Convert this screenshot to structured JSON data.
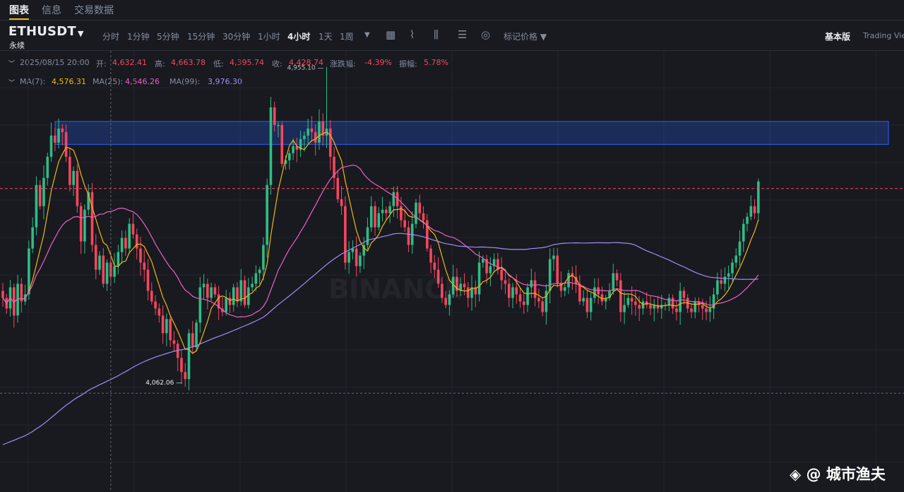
{
  "tabs": {
    "chart": "图表",
    "info": "信息",
    "trading_data": "交易数据"
  },
  "toolbar": {
    "symbol": "ETHUSDT",
    "contract_type": "永续",
    "intervals": [
      "分时",
      "1分钟",
      "5分钟",
      "15分钟",
      "30分钟",
      "1小时",
      "4小时",
      "1天",
      "1周"
    ],
    "active_interval": "4小时",
    "mark_price_label": "标记价格",
    "basic_view": "基本版",
    "tv_view": "Trading View"
  },
  "ohlc": {
    "date": "2025/08/15 20:00",
    "open_label": "开:",
    "open": "4,632.41",
    "high_label": "高:",
    "high": "4,663.78",
    "low_label": "低:",
    "low": "4,395.74",
    "close_label": "收:",
    "close": "4,428.74",
    "change_label": "涨跌幅:",
    "change": "-4.39%",
    "amplitude_label": "振幅:",
    "amplitude": "5.78%"
  },
  "ma": {
    "ma7_label": "MA(7):",
    "ma7": "4,576.31",
    "ma25_label": "MA(25):",
    "ma25": "4,546.26",
    "ma99_label": "MA(99):",
    "ma99": "3,976.30"
  },
  "chart_data": {
    "type": "candlestick",
    "interval": "4h",
    "y_range": [
      3750,
      5000
    ],
    "high_marker": "4,955.10",
    "low_marker": "4,062.06",
    "resistance_zone": [
      4735,
      4800
    ],
    "current_price_line": 4610,
    "colors": {
      "up": "#2ebd85",
      "down": "#f6465d",
      "ma7": "#f0b90b",
      "ma25": "#ee5fc4",
      "ma99": "#a58cf5"
    },
    "closes": [
      4300,
      4270,
      4330,
      4250,
      4340,
      4290,
      4310,
      4440,
      4500,
      4620,
      4560,
      4640,
      4700,
      4760,
      4740,
      4780,
      4770,
      4700,
      4620,
      4660,
      4560,
      4460,
      4550,
      4600,
      4450,
      4380,
      4420,
      4340,
      4400,
      4360,
      4390,
      4430,
      4470,
      4440,
      4510,
      4480,
      4440,
      4400,
      4380,
      4320,
      4290,
      4270,
      4250,
      4200,
      4240,
      4180,
      4170,
      4130,
      4090,
      4070,
      4200,
      4160,
      4230,
      4330,
      4340,
      4300,
      4330,
      4310,
      4270,
      4260,
      4300,
      4280,
      4330,
      4290,
      4350,
      4280,
      4330,
      4340,
      4370,
      4380,
      4450,
      4620,
      4840,
      4790,
      4790,
      4680,
      4690,
      4710,
      4730,
      4720,
      4750,
      4760,
      4780,
      4770,
      4740,
      4800,
      4760,
      4780,
      4700,
      4640,
      4580,
      4560,
      4400,
      4430,
      4440,
      4390,
      4420,
      4450,
      4500,
      4560,
      4500,
      4540,
      4550,
      4540,
      4560,
      4600,
      4560,
      4520,
      4500,
      4450,
      4510,
      4570,
      4540,
      4520,
      4440,
      4400,
      4380,
      4340,
      4300,
      4280,
      4310,
      4360,
      4320,
      4340,
      4330,
      4300,
      4330,
      4310,
      4400,
      4410,
      4370,
      4390,
      4410,
      4380,
      4350,
      4340,
      4300,
      4330,
      4310,
      4290,
      4280,
      4330,
      4350,
      4300,
      4290,
      4260,
      4320,
      4410,
      4420,
      4340,
      4320,
      4330,
      4370,
      4360,
      4340,
      4290,
      4300,
      4260,
      4300,
      4330,
      4310,
      4290,
      4300,
      4320,
      4370,
      4350,
      4260,
      4280,
      4300,
      4290,
      4280,
      4270,
      4290,
      4280,
      4270,
      4280,
      4270,
      4280,
      4280,
      4300,
      4270,
      4260,
      4320,
      4300,
      4270,
      4260,
      4290,
      4280,
      4270,
      4260,
      4270,
      4310,
      4350,
      4340,
      4360,
      4370,
      4400,
      4420,
      4460,
      4510,
      4530,
      4560,
      4540,
      4630
    ]
  }
}
